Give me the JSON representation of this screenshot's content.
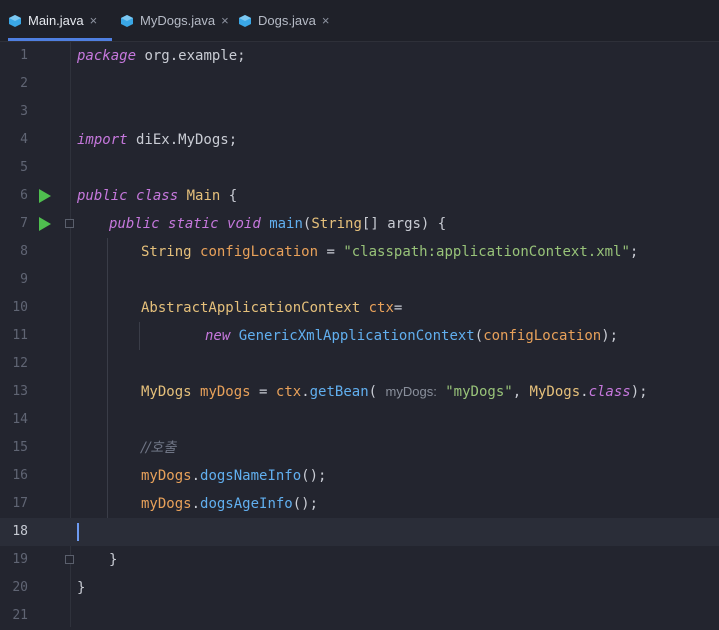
{
  "tabs": [
    {
      "label": "Main.java",
      "active": true
    },
    {
      "label": "MyDogs.java",
      "active": false
    },
    {
      "label": "Dogs.java",
      "active": false
    }
  ],
  "close_glyph": "×",
  "colors": {
    "accent": "#4f7fe0",
    "run": "#4fbf4f",
    "java_icon": "#3aa7e6"
  },
  "line_numbers": [
    "1",
    "2",
    "3",
    "4",
    "5",
    "6",
    "7",
    "8",
    "9",
    "10",
    "11",
    "12",
    "13",
    "14",
    "15",
    "16",
    "17",
    "18",
    "19",
    "20",
    "21"
  ],
  "current_line": 18,
  "code": {
    "l1": {
      "kw": "package",
      "rest": " org.example;"
    },
    "l4": {
      "kw": "import",
      "rest": " diEx.MyDogs;"
    },
    "l6": {
      "kw1": "public",
      "kw2": "class",
      "name": "Main",
      "rest": " {"
    },
    "l7": {
      "kw1": "public",
      "kw2": "static",
      "kw3": "void",
      "fn": "main",
      "p1": "(",
      "type": "String",
      "rest": "[] args) {"
    },
    "l8": {
      "type": "String",
      "var": "configLocation",
      "eq": " = ",
      "str": "\"classpath:applicationContext.xml\"",
      "end": ";"
    },
    "l10": {
      "type": "AbstractApplicationContext",
      "var": "ctx",
      "eq": "="
    },
    "l11": {
      "kw": "new",
      "fn": "GenericXmlApplicationContext",
      "p1": "(",
      "var": "configLocation",
      "end": ");"
    },
    "l13": {
      "type": "MyDogs",
      "var": "myDogs",
      "eq": " = ",
      "obj": "ctx",
      "dot": ".",
      "fn": "getBean",
      "p1": "(",
      "hint": "myDogs:",
      "str": "\"myDogs\"",
      "sep": ", ",
      "type2": "MyDogs",
      "dot2": ".",
      "kw": "class",
      "end": ");"
    },
    "l15": {
      "comment": "//호출"
    },
    "l16": {
      "var": "myDogs",
      "dot": ".",
      "fn": "dogsNameInfo",
      "end": "();"
    },
    "l17": {
      "var": "myDogs",
      "dot": ".",
      "fn": "dogsAgeInfo",
      "end": "();"
    },
    "l19": {
      "text": "}"
    },
    "l20": {
      "text": "}"
    }
  }
}
